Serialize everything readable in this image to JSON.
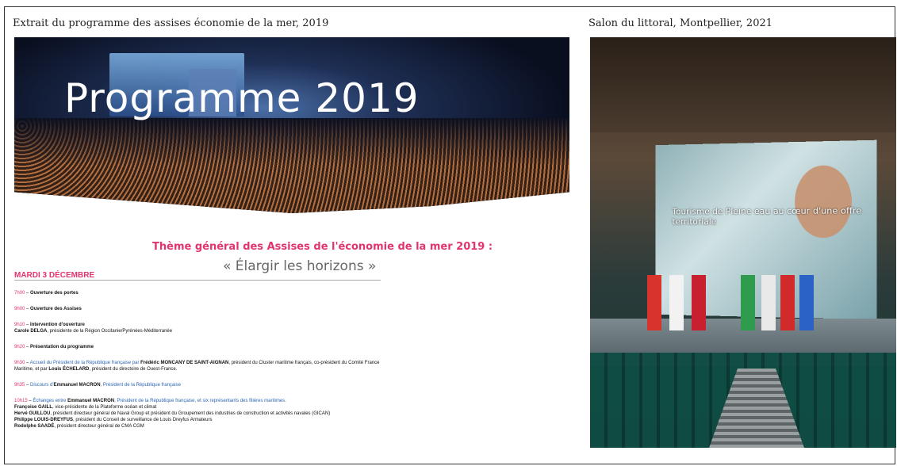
{
  "left_caption": "Extrait du programme des assises économie de la mer, 2019",
  "right_caption": "Salon du littoral, Montpellier, 2021",
  "hero_title": "Programme 2019",
  "theme_line": "Thème général des Assises de l'économie de la mer 2019 :",
  "theme_quote": "« Élargir les horizons »",
  "program": {
    "day": "MARDI 3 DÉCEMBRE",
    "items": [
      {
        "time": "7h00",
        "text": "Ouverture des portes"
      },
      {
        "time": "9h00",
        "text": "Ouverture des Assises"
      },
      {
        "time": "9h10",
        "text": "Intervention d'ouverture",
        "detail_name": "Carole DELGA",
        "detail": ", présidente de la Région Occitanie/Pyrénées-Méditerranée"
      },
      {
        "time": "9h20",
        "text": "Présentation du programme"
      },
      {
        "time": "9h30",
        "text": "Accueil du Président de la République française par ",
        "name1": "Frédéric MONCANY DE SAINT-AIGNAN",
        "text2": ", président du Cluster maritime français, co-président du Comité France Maritime, et par ",
        "name2": "Louis ÉCHELARD",
        "text3": ", président du directoire de Ouest-France."
      },
      {
        "time": "9h35",
        "text": "Discours d'",
        "name1": "Emmanuel MACRON",
        "text2": ", Président de la République française"
      },
      {
        "time": "10h15",
        "text": "Échanges entre ",
        "name1": "Emmanuel MACRON",
        "text2": ", Président de la République française, et six représentants des filières maritimes."
      }
    ],
    "participants": [
      {
        "name": "Françoise GAILL",
        "role": ", vice-présidente de la Plateforme océan et climat"
      },
      {
        "name": "Hervé GUILLOU",
        "role": ", président directeur général de Naval Group et président du Groupement des industries de construction et activités navales (GICAN)"
      },
      {
        "name": "Philippe LOUIS-DREYFUS",
        "role": ", président du Conseil de surveillance de Louis Dreyfus Armateurs"
      },
      {
        "name": "Rodolphe SAADÉ",
        "role": ", président directeur général de CMA CGM"
      }
    ]
  },
  "photo_screen_text": "Tourisme de Pleine eau au cœur d'une offre territoriale",
  "colors": {
    "accent": "#e1356d",
    "link": "#2a67b6"
  }
}
